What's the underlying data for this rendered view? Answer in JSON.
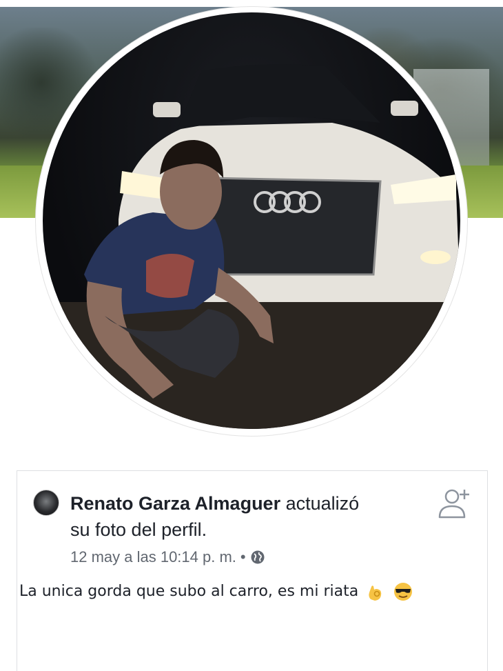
{
  "post": {
    "author": "Renato Garza Almaguer",
    "action_line1": " actualizó",
    "action_line2": "su foto del perfil.",
    "timestamp": "12 may a las 10:14 p. m.",
    "separator": "•",
    "privacy_icon": "globe-icon",
    "status_text": "La unica gorda que subo al carro, es mi riata",
    "emojis": [
      "ok-hand-emoji",
      "sunglasses-face-emoji"
    ],
    "add_friend_icon": "add-friend-icon"
  },
  "colors": {
    "text_primary": "#1d2129",
    "text_secondary": "#616770",
    "card_border": "#dddfe2"
  }
}
